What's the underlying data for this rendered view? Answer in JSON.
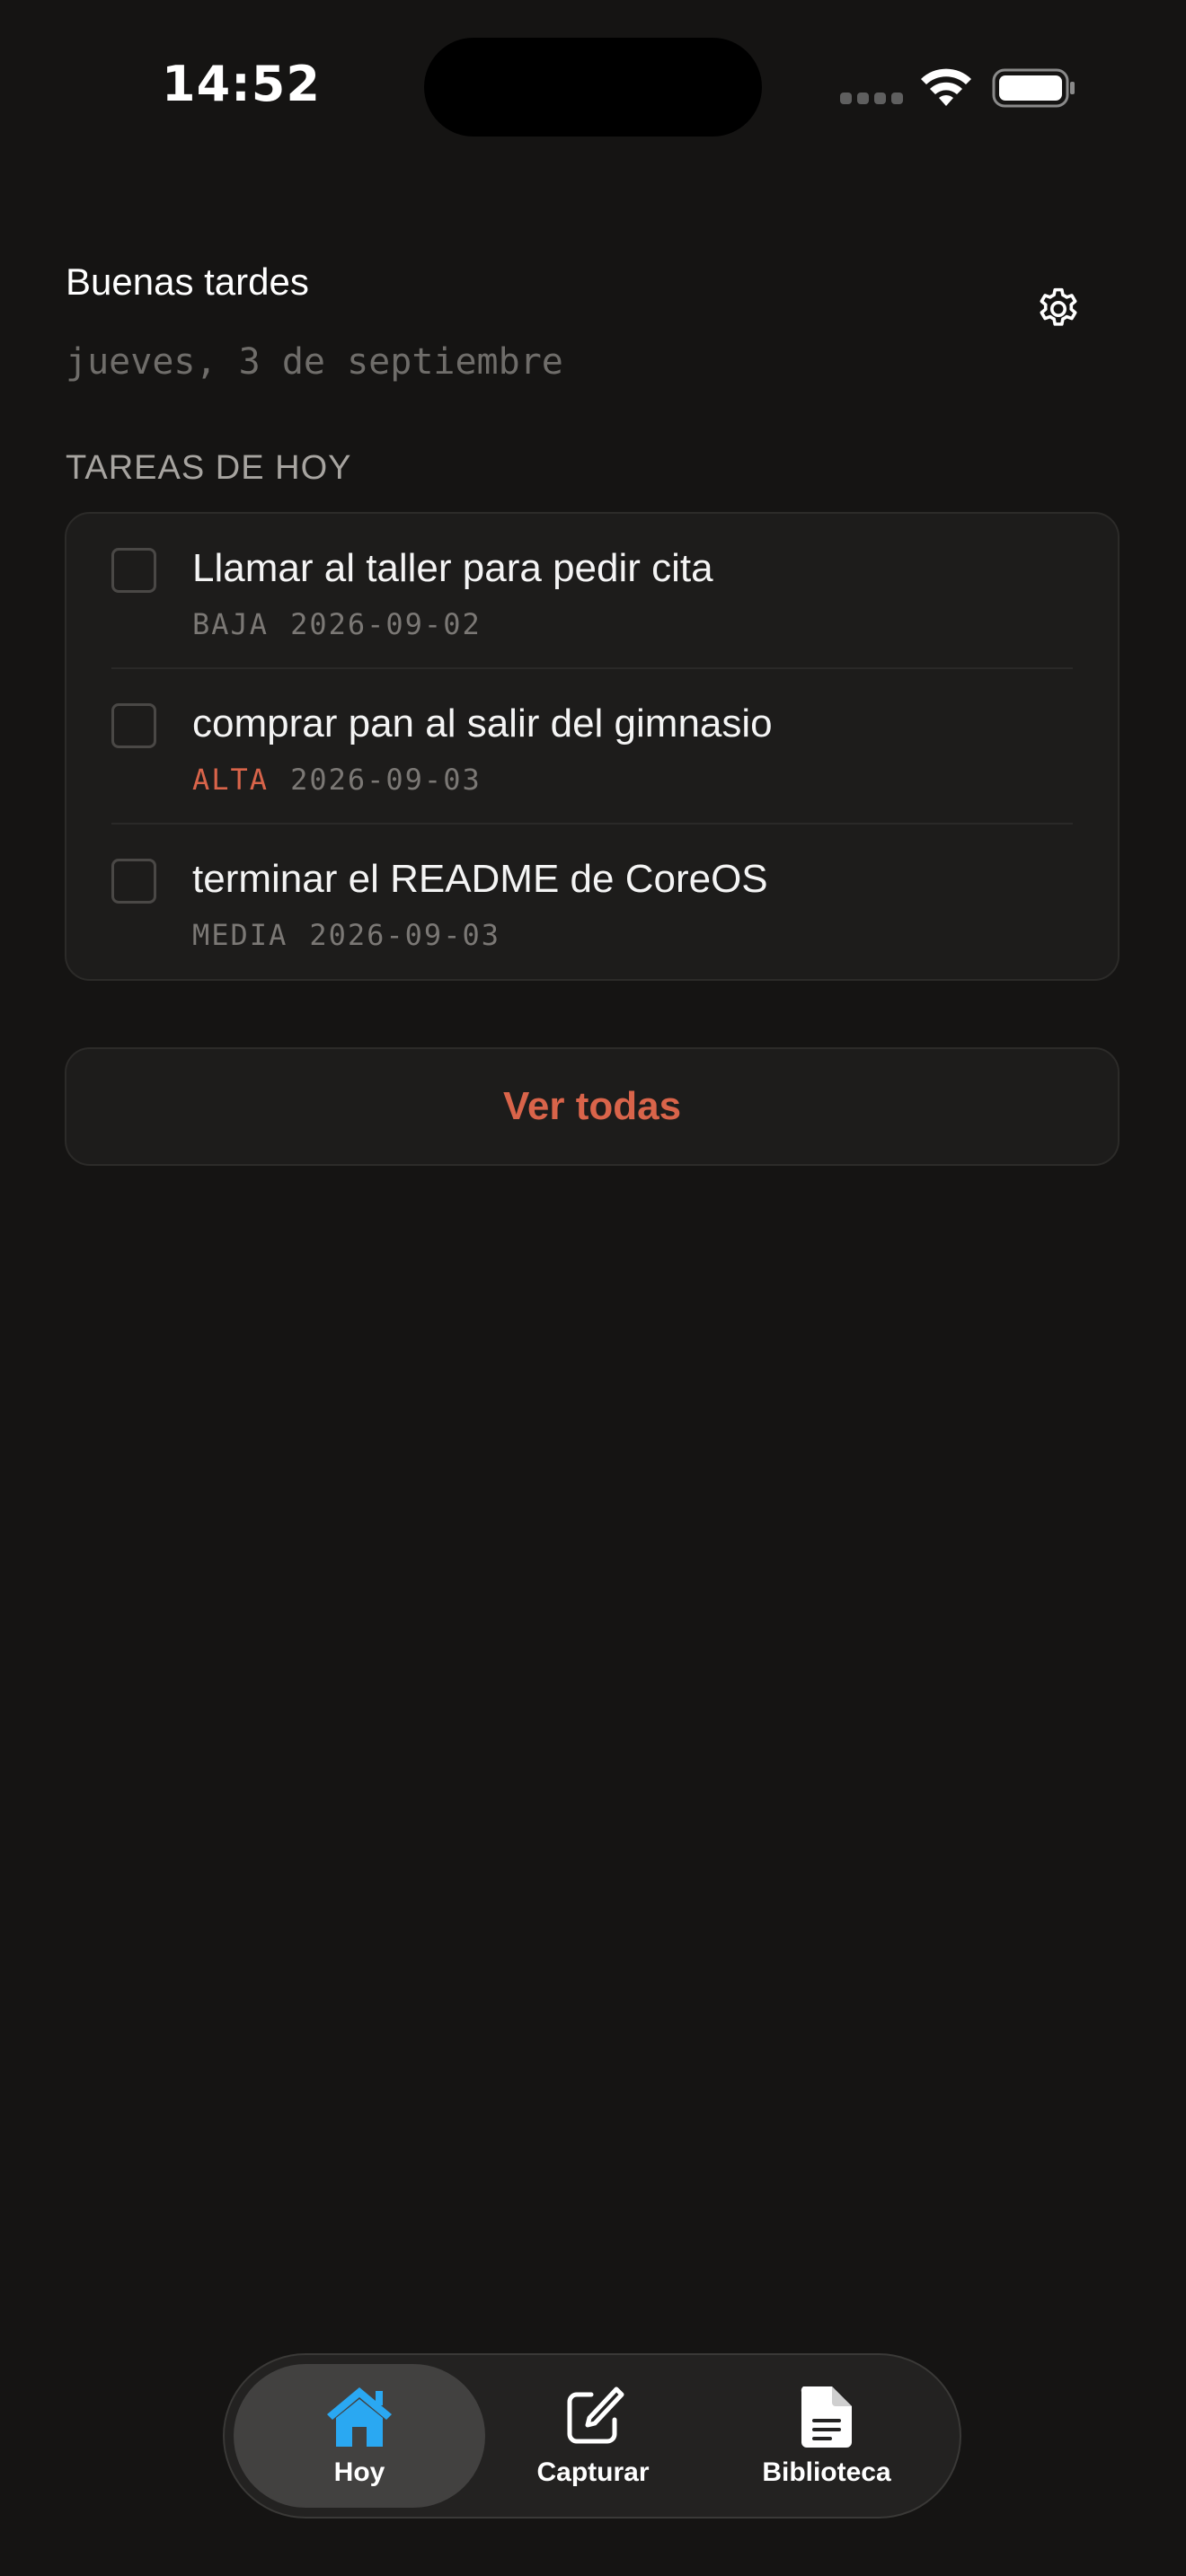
{
  "status_bar": {
    "time": "14:52"
  },
  "header": {
    "greeting": "Buenas tardes",
    "date": "jueves, 3 de septiembre",
    "settings_icon": "gear-icon"
  },
  "section": {
    "title": "TAREAS DE HOY"
  },
  "tasks": [
    {
      "title": "Llamar al taller para pedir cita",
      "priority": "BAJA",
      "date": "2026-09-02",
      "done": false
    },
    {
      "title": "comprar pan al salir del gimnasio",
      "priority": "ALTA",
      "date": "2026-09-03",
      "done": false
    },
    {
      "title": "terminar el README de CoreOS",
      "priority": "MEDIA",
      "date": "2026-09-03",
      "done": false
    }
  ],
  "actions": {
    "view_all": "Ver todas"
  },
  "tab_bar": {
    "items": [
      {
        "label": "Hoy",
        "icon": "house-icon",
        "active": true
      },
      {
        "label": "Capturar",
        "icon": "compose-icon",
        "active": false
      },
      {
        "label": "Biblioteca",
        "icon": "document-icon",
        "active": false
      }
    ]
  },
  "colors": {
    "background": "#151413",
    "accent": "#d9644a",
    "active_tab_icon": "#2aa8f2"
  }
}
